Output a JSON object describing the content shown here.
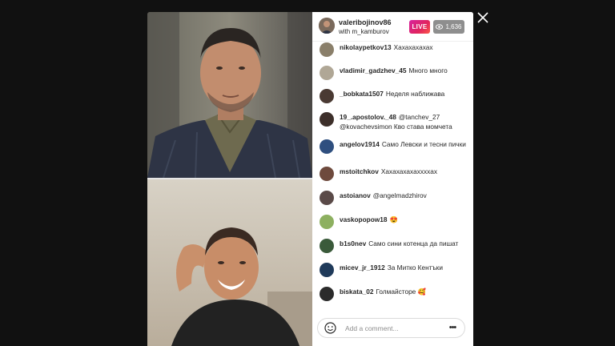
{
  "header": {
    "host_username": "valeribojinov86",
    "with_text": "with m_kamburov",
    "live_label": "LIVE",
    "viewer_count": "1,636"
  },
  "comments": [
    {
      "user": "nikolaypetkov13",
      "text": "Хахахахахах",
      "color": "#8a7f6a"
    },
    {
      "user": "vladimir_gadzhev_45",
      "text": "Много много",
      "color": "#b0a796"
    },
    {
      "user": "_bobkata1507",
      "text": "Неделя наближава",
      "color": "#4a3a33"
    },
    {
      "user": "19_.apostolov._48",
      "text": "@tanchev_27 @kovachevsimon Кво става момчета",
      "color": "#3d2f2a"
    },
    {
      "user": "angelov1914",
      "text": "Само Левски и тесни пички",
      "color": "#2f4f7f"
    },
    {
      "user": "mstoitchkov",
      "text": "Хахахахахаxxxхах",
      "color": "#6e4a3d"
    },
    {
      "user": "astoianov",
      "text": "@angelmadzhirov",
      "color": "#5a4a48"
    },
    {
      "user": "vaskopopow18",
      "text": "😍",
      "color": "#8db060"
    },
    {
      "user": "b1s0nev",
      "text": "Само сини котенца да пишат",
      "color": "#3a5a3a"
    },
    {
      "user": "micev_jr_1912",
      "text": "За Митко Кентъки",
      "color": "#1f3a5a"
    },
    {
      "user": "biskata_02",
      "text": "Голмайсторе 🥰",
      "color": "#2b2b2b"
    }
  ],
  "comment_bar": {
    "placeholder": "Add a comment...",
    "emoji_icon": "smiley-icon",
    "more_icon": "ellipsis-icon",
    "more_label": "•••"
  },
  "colors": {
    "backdrop": "#111111",
    "live_gradient_start": "#d6249f",
    "live_gradient_end": "#fd5949",
    "viewer_badge": "#8e8e8e"
  }
}
